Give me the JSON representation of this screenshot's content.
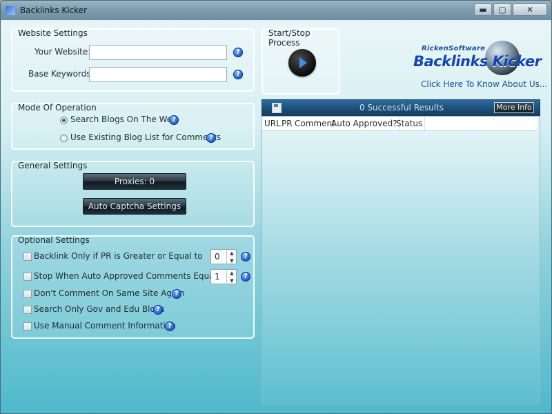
{
  "window": {
    "title": "Backlinks Kicker",
    "controls": {
      "minimize": "▬",
      "maximize": "▢",
      "close": "✕"
    }
  },
  "website_settings": {
    "title": "Website Settings",
    "your_website_label": "Your Website:",
    "your_website_value": "",
    "base_keywords_label": "Base Keywords:",
    "base_keywords_value": ""
  },
  "mode_of_operation": {
    "title": "Mode Of Operation",
    "options": [
      {
        "label": "Search Blogs On The Web",
        "selected": true
      },
      {
        "label": "Use Existing Blog List for Comments",
        "selected": false
      }
    ]
  },
  "general_settings": {
    "title": "General Settings",
    "proxies_label": "Proxies: 0",
    "auto_captcha_label": "Auto Captcha Settings"
  },
  "optional_settings": {
    "title": "Optional Settings",
    "items": [
      {
        "label": "Backlink Only if PR is Greater or Equal to",
        "checked": false,
        "value": "0"
      },
      {
        "label": "Stop When Auto Approved Comments Equal to",
        "checked": false,
        "value": "1"
      },
      {
        "label": "Don't Comment On Same Site Again",
        "checked": false
      },
      {
        "label": "Search Only Gov and Edu Blogs",
        "checked": false
      },
      {
        "label": "Use Manual Comment Information",
        "checked": false
      }
    ]
  },
  "process": {
    "title": "Start/Stop Process"
  },
  "logo": {
    "small_text": "RickenSoftware",
    "main_text": "Backlinks Kicker",
    "link_text": "Click Here To Know About Us..."
  },
  "results": {
    "count_text": "0 Successful Results",
    "more_info_label": "More Info",
    "columns": [
      "URL",
      "PR",
      "Comment",
      "Auto Approved?",
      "Status"
    ]
  },
  "icons": {
    "help": "?",
    "save": "save-icon",
    "play": "play-icon",
    "spin_up": "▲",
    "spin_down": "▼"
  },
  "colors": {
    "accent": "#1d58c9",
    "header_bar": "#1d4f79",
    "button_dark": "#1b2830"
  }
}
